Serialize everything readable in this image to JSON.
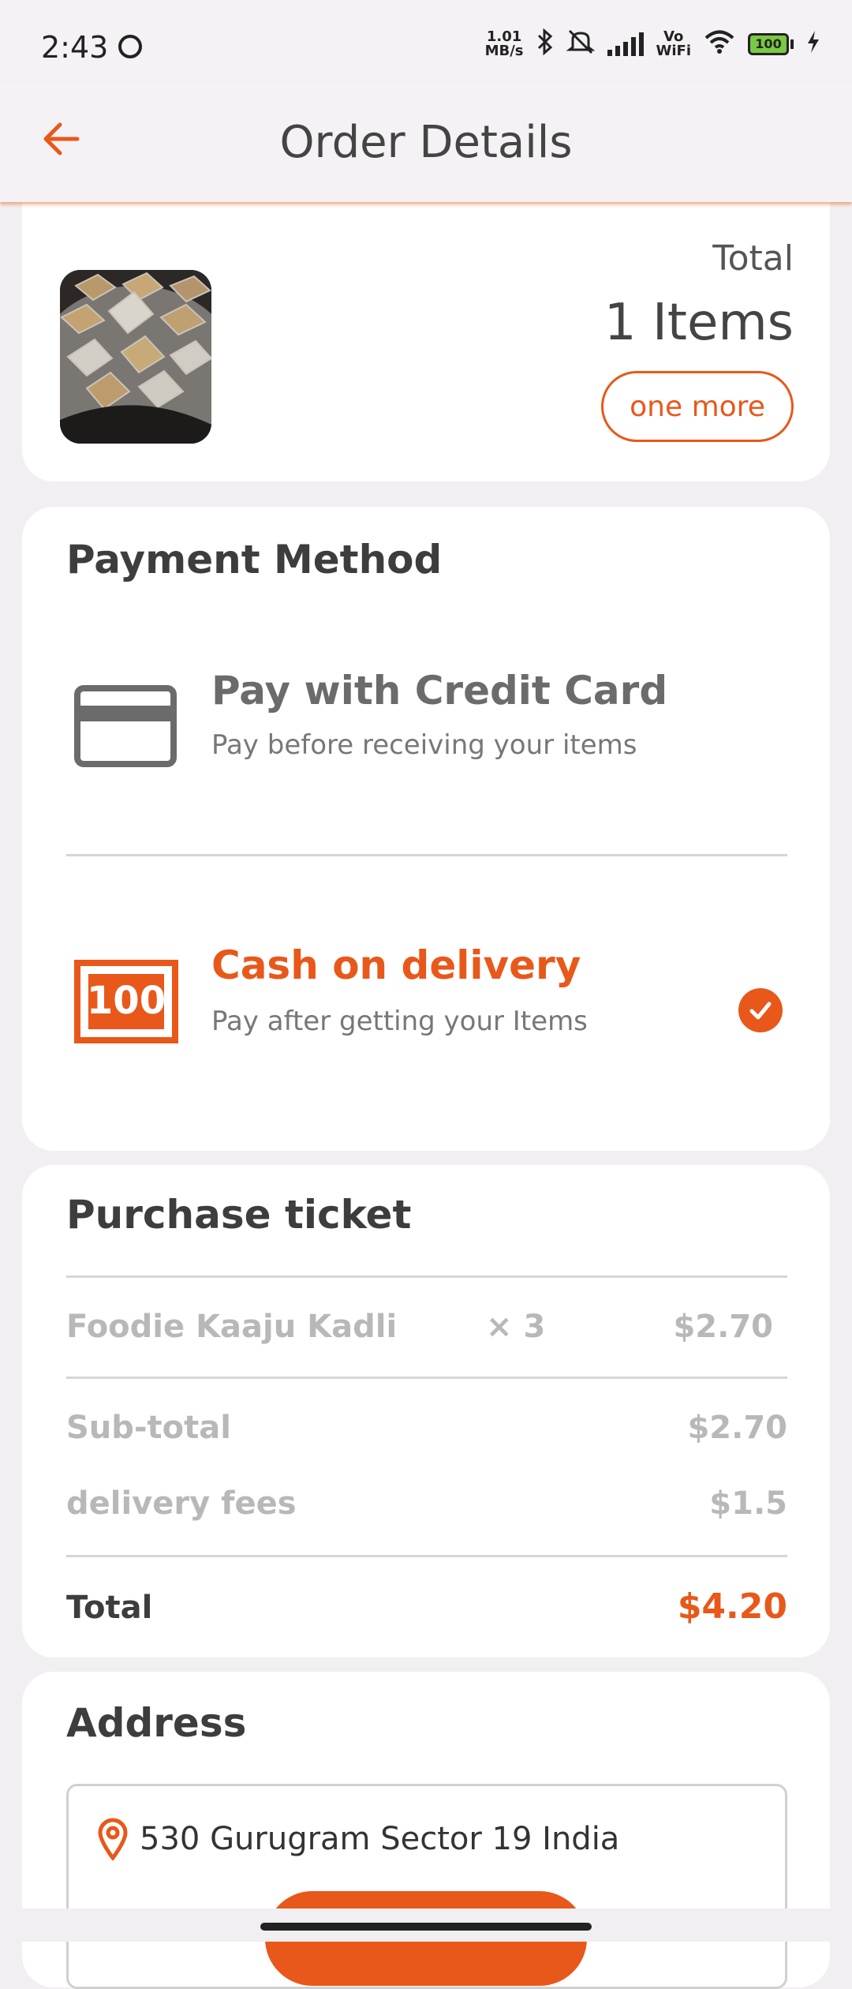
{
  "status_bar": {
    "time": "2:43",
    "net_speed_value": "1.01",
    "net_speed_unit": "MB/s",
    "vowifi_top": "Vo",
    "vowifi_bottom": "WiFi",
    "battery": "100",
    "icons": [
      "face-notification-icon",
      "bluetooth-icon",
      "mute-icon",
      "signal-icon",
      "wifi-icon",
      "battery-icon",
      "charging-icon"
    ]
  },
  "app_bar": {
    "title": "Order Details",
    "back_icon": "arrow-left-icon"
  },
  "order_summary": {
    "total_label": "Total",
    "items_count": "1 Items",
    "one_more_label": "one more"
  },
  "payment": {
    "title": "Payment Method",
    "options": [
      {
        "title": "Pay with Credit Card",
        "subtitle": "Pay before receiving your items",
        "icon": "credit-card-icon",
        "selected": false
      },
      {
        "title": "Cash on delivery",
        "subtitle": "Pay after getting your Items",
        "icon": "cash-icon",
        "icon_text": "100",
        "selected": true
      }
    ]
  },
  "ticket": {
    "title": "Purchase ticket",
    "items": [
      {
        "name": "Foodie Kaaju Kadli",
        "qty": "× 3",
        "price": "$2.70"
      }
    ],
    "subtotal_label": "Sub-total",
    "subtotal": "$2.70",
    "delivery_label": "delivery fees",
    "delivery": "$1.5",
    "total_label": "Total",
    "total": "$4.20"
  },
  "address": {
    "title": "Address",
    "line": "530 Gurugram Sector 19 India"
  },
  "colors": {
    "accent": "#e8581a",
    "background": "#f1eff1",
    "card": "#ffffff",
    "muted": "#b8b8b8"
  }
}
